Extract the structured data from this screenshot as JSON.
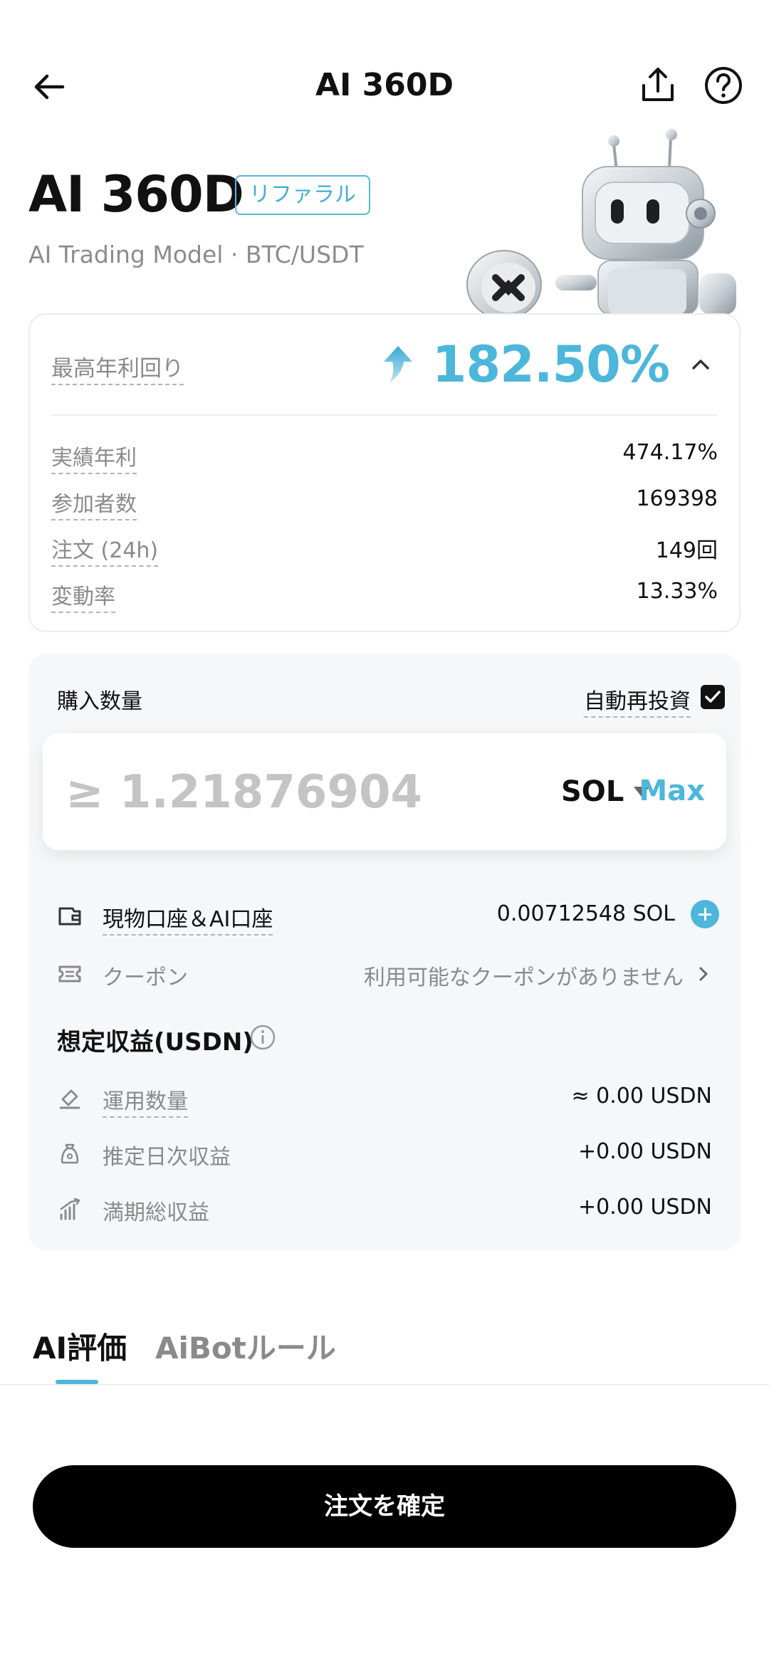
{
  "header": {
    "title": "AI 360D"
  },
  "hero": {
    "title": "AI 360D",
    "badge": "リファラル",
    "subtitle": "AI Trading Model · BTC/USDT"
  },
  "stats": {
    "max_label": "最高年利回り",
    "max_value": "182.50%",
    "rows": [
      {
        "label": "実績年利",
        "value": "474.17%"
      },
      {
        "label": "参加者数",
        "value": "169398"
      },
      {
        "label": "注文 (24h)",
        "value": "149回"
      },
      {
        "label": "変動率",
        "value": "13.33%"
      }
    ]
  },
  "purchase": {
    "qty_label": "購入数量",
    "auto_reinvest_label": "自動再投資",
    "auto_reinvest_checked": true,
    "amount_placeholder": "≥ 1.21876904",
    "coin": "SOL",
    "max_label": "Max",
    "account_label": "現物口座＆AI口座",
    "account_balance": "0.00712548 SOL",
    "coupon_label": "クーポン",
    "coupon_value": "利用可能なクーポンがありません"
  },
  "estimate": {
    "title": "想定収益(USDN)",
    "rows": [
      {
        "label": "運用数量",
        "value": "≈ 0.00 USDN",
        "icon": "stake-icon"
      },
      {
        "label": "推定日次収益",
        "value": "+0.00 USDN",
        "icon": "money-bag-icon"
      },
      {
        "label": "満期総収益",
        "value": "+0.00 USDN",
        "icon": "growth-chart-icon"
      }
    ]
  },
  "tabs": [
    {
      "label": "AI評価",
      "active": true
    },
    {
      "label": "AiBotルール",
      "active": false
    }
  ],
  "confirm_label": "注文を確定",
  "colors": {
    "accent": "#4db6db",
    "button": "#000000",
    "panel": "#f6f7f9"
  }
}
